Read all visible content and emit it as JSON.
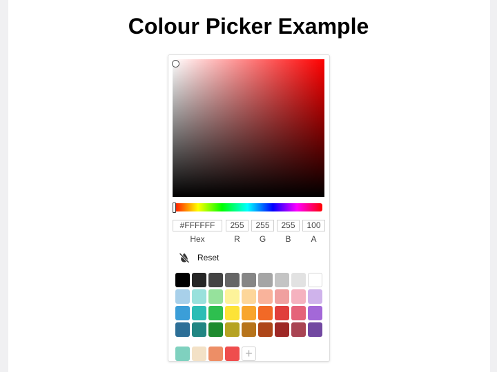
{
  "page": {
    "title": "Colour Picker Example"
  },
  "picker": {
    "hue_color": "#ff0000",
    "fields": [
      {
        "key": "hex",
        "value": "#FFFFFF",
        "label": "Hex"
      },
      {
        "key": "r",
        "value": "255",
        "label": "R"
      },
      {
        "key": "g",
        "value": "255",
        "label": "G"
      },
      {
        "key": "b",
        "value": "255",
        "label": "B"
      },
      {
        "key": "a",
        "value": "100",
        "label": "A"
      }
    ],
    "reset_label": "Reset",
    "reset_icon": "color-off-icon",
    "swatch_rows": [
      [
        "#000000",
        "#262626",
        "#434343",
        "#666666",
        "#868686",
        "#a5a5a5",
        "#c4c4c4",
        "#e2e2e2",
        "#ffffff"
      ],
      [
        "#a8d0ea",
        "#99e1dc",
        "#96e29c",
        "#fdf39a",
        "#fdd69a",
        "#f9b39b",
        "#f0a09f",
        "#f5b2bf",
        "#cfb3eb"
      ],
      [
        "#3b9ed8",
        "#2dbdb5",
        "#2ebf4f",
        "#fde337",
        "#f8a52c",
        "#f26926",
        "#e03e3c",
        "#e5637a",
        "#a368d8"
      ],
      [
        "#2d6f97",
        "#228683",
        "#1e8b2f",
        "#b6a322",
        "#b7741b",
        "#ae4619",
        "#9e2826",
        "#a94453",
        "#7248a1"
      ]
    ],
    "custom_swatches": [
      "#7fd1bf",
      "#f3e1c6",
      "#ed8e66",
      "#ef4d4d"
    ],
    "add_label": "+"
  }
}
